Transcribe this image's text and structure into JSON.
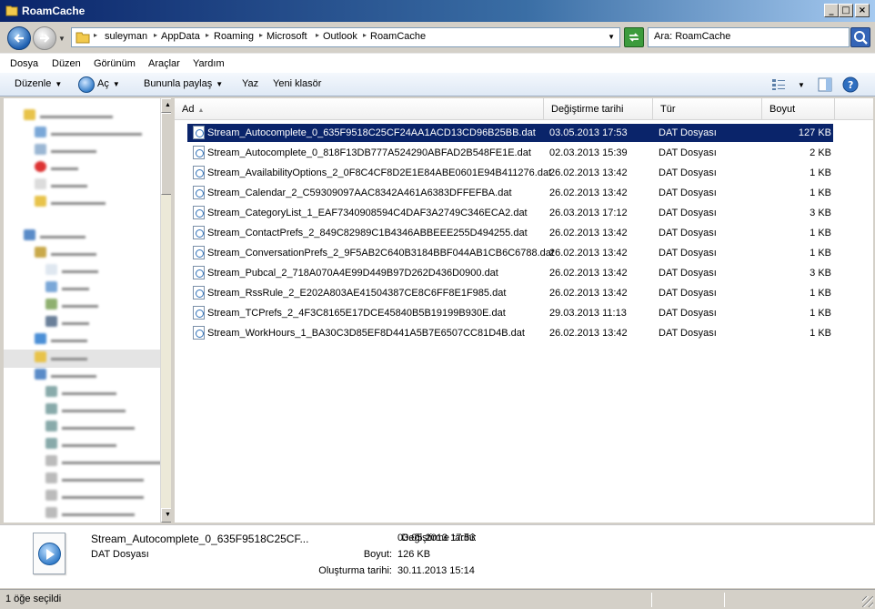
{
  "window": {
    "title": "RoamCache"
  },
  "window_buttons": {
    "minimize": "_",
    "maximize": "□",
    "close": "×"
  },
  "address": {
    "breadcrumbs": [
      "suleyman",
      "AppData",
      "Roaming",
      "Microsoft",
      "Outlook",
      "RoamCache"
    ]
  },
  "search": {
    "placeholder": "Ara: RoamCache"
  },
  "menu": [
    "Dosya",
    "Düzen",
    "Görünüm",
    "Araçlar",
    "Yardım"
  ],
  "toolbar": {
    "organize": "Düzenle",
    "open": "Aç",
    "share": "Bununla paylaş",
    "print": "Yaz",
    "new_folder": "Yeni klasör"
  },
  "columns": {
    "name": "Ad",
    "date": "Değiştirme tarihi",
    "type": "Tür",
    "size": "Boyut"
  },
  "files": [
    {
      "name": "Stream_Autocomplete_0_635F9518C25CF24AA1ACD13CD96B25BB.dat",
      "date": "03.05.2013 17:53",
      "type": "DAT Dosyası",
      "size": "127 KB",
      "selected": true
    },
    {
      "name": "Stream_Autocomplete_0_818F13DB777A524290ABFAD2B548FE1E.dat",
      "date": "02.03.2013 15:39",
      "type": "DAT Dosyası",
      "size": "2 KB"
    },
    {
      "name": "Stream_AvailabilityOptions_2_0F8C4CF8D2E1E84ABE0601E94B411276.dat",
      "date": "26.02.2013 13:42",
      "type": "DAT Dosyası",
      "size": "1 KB"
    },
    {
      "name": "Stream_Calendar_2_C59309097AAC8342A461A6383DFFEFBA.dat",
      "date": "26.02.2013 13:42",
      "type": "DAT Dosyası",
      "size": "1 KB"
    },
    {
      "name": "Stream_CategoryList_1_EAF7340908594C4DAF3A2749C346ECA2.dat",
      "date": "26.03.2013 17:12",
      "type": "DAT Dosyası",
      "size": "3 KB"
    },
    {
      "name": "Stream_ContactPrefs_2_849C82989C1B4346ABBEEE255D494255.dat",
      "date": "26.02.2013 13:42",
      "type": "DAT Dosyası",
      "size": "1 KB"
    },
    {
      "name": "Stream_ConversationPrefs_2_9F5AB2C640B3184BBF044AB1CB6C6788.dat",
      "date": "26.02.2013 13:42",
      "type": "DAT Dosyası",
      "size": "1 KB"
    },
    {
      "name": "Stream_Pubcal_2_718A070A4E99D449B97D262D436D0900.dat",
      "date": "26.02.2013 13:42",
      "type": "DAT Dosyası",
      "size": "3 KB"
    },
    {
      "name": "Stream_RssRule_2_E202A803AE41504387CE8C6FF8E1F985.dat",
      "date": "26.02.2013 13:42",
      "type": "DAT Dosyası",
      "size": "1 KB"
    },
    {
      "name": "Stream_TCPrefs_2_4F3C8165E17DCE45840B5B19199B930E.dat",
      "date": "29.03.2013 11:13",
      "type": "DAT Dosyası",
      "size": "1 KB"
    },
    {
      "name": "Stream_WorkHours_1_BA30C3D85EF8D441A5B7E6507CC81D4B.dat",
      "date": "26.02.2013 13:42",
      "type": "DAT Dosyası",
      "size": "1 KB"
    }
  ],
  "details": {
    "name": "Stream_Autocomplete_0_635F9518C25CF...",
    "type": "DAT Dosyası",
    "modified_label": "Değiştirme tarihi:",
    "modified_value": "03.05.2013 17:53",
    "size_label": "Boyut:",
    "size_value": "126 KB",
    "created_label": "Oluşturma tarihi:",
    "created_value": "30.11.2013 15:14"
  },
  "status": {
    "text": "1 öğe seçildi"
  }
}
